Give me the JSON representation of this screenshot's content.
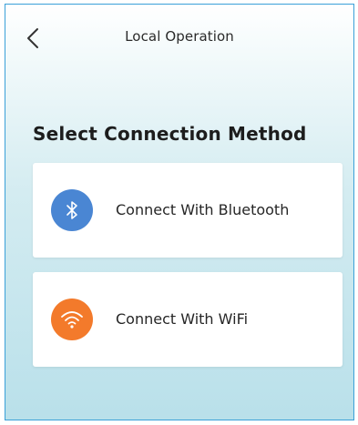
{
  "header": {
    "title": "Local Operation",
    "back_icon": "chevron-left-icon"
  },
  "main": {
    "section_title": "Select Connection Method",
    "options": [
      {
        "label": "Connect With Bluetooth",
        "icon": "bluetooth-icon",
        "icon_color": "#4a86d3"
      },
      {
        "label": "Connect With WiFi",
        "icon": "wifi-icon",
        "icon_color": "#f37a2b"
      }
    ]
  },
  "colors": {
    "background_bottom": "#b9e0ea",
    "card": "#ffffff",
    "border": "#3aa0d8"
  }
}
